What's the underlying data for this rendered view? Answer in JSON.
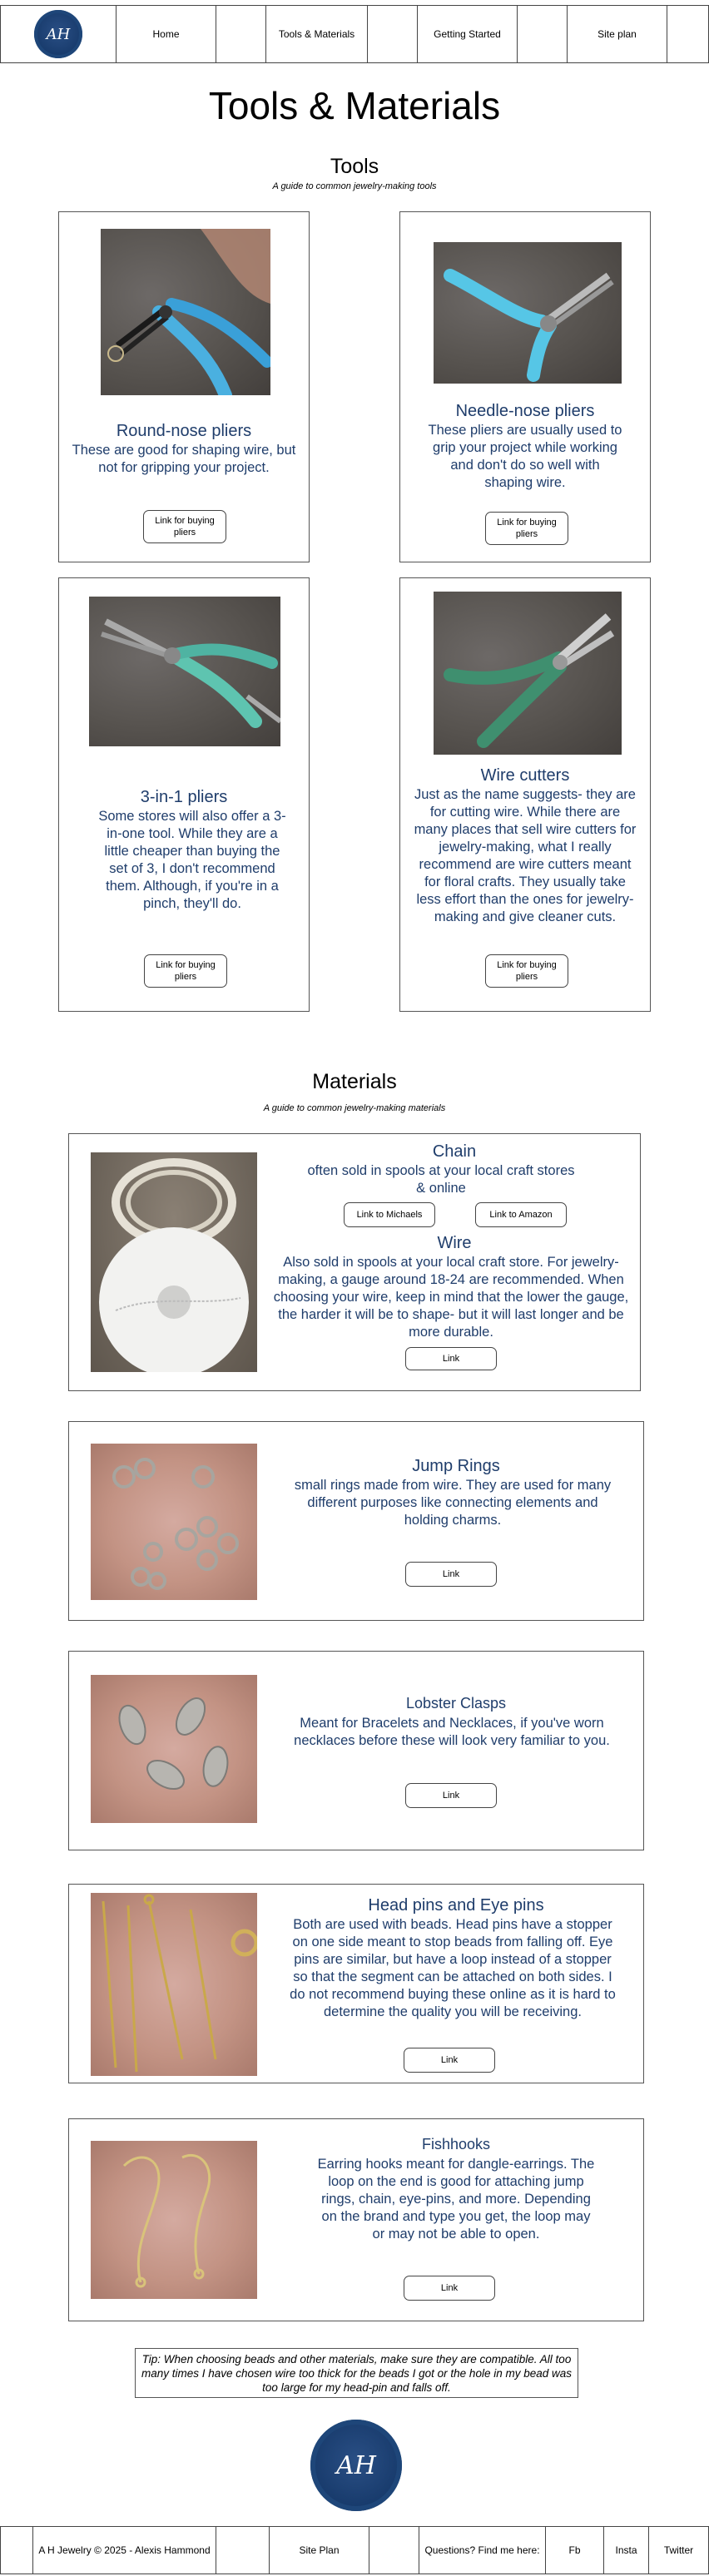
{
  "nav": {
    "logo_text": "AH",
    "items": [
      "Home",
      "Tools & Materials",
      "Getting Started",
      "Site plan"
    ]
  },
  "page_title": "Tools & Materials",
  "tools": {
    "title": "Tools",
    "subtitle": "A guide to common jewelry-making tools",
    "cards": [
      {
        "name": "Round-nose pliers",
        "text": "These are good for shaping wire, but not for gripping your project.",
        "button": "Link for buying pliers"
      },
      {
        "name": "Needle-nose pliers",
        "text": "These pliers are usually used to grip your project while working and don't do so well with shaping wire.",
        "button": "Link for buying pliers"
      },
      {
        "name": "3-in-1 pliers",
        "text": "Some stores will also offer a 3-in-one tool. While they are a little cheaper than buying the set of 3, I don't recommend them. Although, if you're in a pinch, they'll do.",
        "button": "Link for buying pliers"
      },
      {
        "name": "Wire cutters",
        "text": "Just as the name suggests- they are for cutting wire. While there are many places that sell wire cutters for jewelry-making, what I really recommend are wire cutters meant for floral crafts. They usually take less effort than the ones for jewelry-making and give cleaner cuts.",
        "button": "Link for buying pliers"
      }
    ]
  },
  "materials": {
    "title": "Materials",
    "subtitle": "A guide to common jewelry-making materials",
    "chain": {
      "name": "Chain",
      "text": "often sold in spools at your local craft stores & online",
      "button_michaels": "Link to Michaels",
      "button_amazon": "Link to Amazon"
    },
    "wire": {
      "name": "Wire",
      "text": "Also sold in spools at your local craft store. For jewelry-making, a gauge around 18-24 are recommended. When choosing your wire, keep in mind that the lower the gauge, the harder it will be to shape- but it will last longer and be more durable.",
      "button": "Link"
    },
    "jump_rings": {
      "name": "Jump Rings",
      "text": "small rings made from wire. They are used for many different purposes like connecting elements and holding charms.",
      "button": "Link"
    },
    "lobster": {
      "name": "Lobster Clasps",
      "text": "Meant for Bracelets and Necklaces, if you've worn necklaces before these will look very familiar to you.",
      "button": "Link"
    },
    "headpins": {
      "name": "Head pins and Eye pins",
      "text": "Both are used with beads. Head pins have a stopper on one side meant to stop beads from falling off. Eye pins are similar, but have a loop instead of a stopper so that the segment can be attached on both sides. I do not recommend buying these online as it is hard to determine the quality you will be receiving.",
      "button": "Link"
    },
    "fishhooks": {
      "name": "Fishhooks",
      "text": "Earring hooks meant for dangle-earrings. The loop on the end is good for attaching jump rings, chain, eye-pins, and more. Depending on the brand and type you get, the loop may or may not be able to open.",
      "button": "Link"
    }
  },
  "tip": "Tip: When choosing beads and other materials, make sure they are compatible. All too many times I have chosen wire too thick for the beads I got or the hole in my bead was too large for my head-pin and falls off.",
  "footer": {
    "copyright": "A H Jewelry © 2025 - Alexis Hammond",
    "site_plan": "Site Plan",
    "questions": "Questions? Find me here:",
    "links": [
      "Fb",
      "Insta",
      "Twitter"
    ]
  },
  "colors": {
    "accent_blue": "#1f3d6b",
    "logo_navy": "#173a6b"
  }
}
